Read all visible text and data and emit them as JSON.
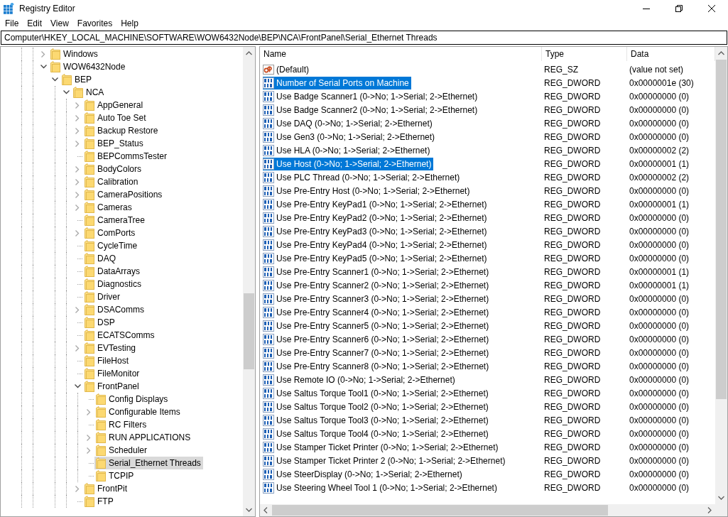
{
  "window": {
    "title": "Registry Editor"
  },
  "menu": [
    "File",
    "Edit",
    "View",
    "Favorites",
    "Help"
  ],
  "address": "Computer\\HKEY_LOCAL_MACHINE\\SOFTWARE\\WOW6432Node\\BEP\\NCA\\FrontPanel\\Serial_Ethernet Threads",
  "tree": [
    {
      "label": "Windows",
      "kind": "collapsed",
      "selected": false
    },
    {
      "label": "WOW6432Node",
      "kind": "expanded",
      "selected": false,
      "children": [
        {
          "label": "BEP",
          "kind": "expanded",
          "selected": false,
          "children": [
            {
              "label": "NCA",
              "kind": "expanded",
              "selected": false,
              "children": [
                {
                  "label": "AppGeneral",
                  "kind": "collapsed",
                  "selected": false
                },
                {
                  "label": "Auto Toe Set",
                  "kind": "collapsed",
                  "selected": false
                },
                {
                  "label": "Backup Restore",
                  "kind": "collapsed",
                  "selected": false
                },
                {
                  "label": "BEP_Status",
                  "kind": "collapsed",
                  "selected": false
                },
                {
                  "label": "BEPCommsTester",
                  "kind": "leaf",
                  "selected": false
                },
                {
                  "label": "BodyColors",
                  "kind": "collapsed",
                  "selected": false
                },
                {
                  "label": "Calibration",
                  "kind": "collapsed",
                  "selected": false
                },
                {
                  "label": "CameraPositions",
                  "kind": "collapsed",
                  "selected": false
                },
                {
                  "label": "Cameras",
                  "kind": "collapsed",
                  "selected": false
                },
                {
                  "label": "CameraTree",
                  "kind": "leaf",
                  "selected": false
                },
                {
                  "label": "ComPorts",
                  "kind": "collapsed",
                  "selected": false
                },
                {
                  "label": "CycleTime",
                  "kind": "leaf",
                  "selected": false
                },
                {
                  "label": "DAQ",
                  "kind": "leaf",
                  "selected": false
                },
                {
                  "label": "DataArrays",
                  "kind": "leaf",
                  "selected": false
                },
                {
                  "label": "Diagnostics",
                  "kind": "leaf",
                  "selected": false
                },
                {
                  "label": "Driver",
                  "kind": "leaf",
                  "selected": false
                },
                {
                  "label": "DSAComms",
                  "kind": "collapsed",
                  "selected": false
                },
                {
                  "label": "DSP",
                  "kind": "leaf",
                  "selected": false
                },
                {
                  "label": "ECATSComms",
                  "kind": "leaf",
                  "selected": false
                },
                {
                  "label": "EVTesting",
                  "kind": "collapsed",
                  "selected": false
                },
                {
                  "label": "FileHost",
                  "kind": "leaf",
                  "selected": false
                },
                {
                  "label": "FileMonitor",
                  "kind": "leaf",
                  "selected": false
                },
                {
                  "label": "FrontPanel",
                  "kind": "expanded",
                  "selected": false,
                  "children": [
                    {
                      "label": "Config Displays",
                      "kind": "leaf",
                      "selected": false
                    },
                    {
                      "label": "Configurable Items",
                      "kind": "collapsed",
                      "selected": false
                    },
                    {
                      "label": "RC Filters",
                      "kind": "leaf",
                      "selected": false
                    },
                    {
                      "label": "RUN APPLICATIONS",
                      "kind": "collapsed",
                      "selected": false
                    },
                    {
                      "label": "Scheduler",
                      "kind": "collapsed",
                      "selected": false
                    },
                    {
                      "label": "Serial_Ethernet Threads",
                      "kind": "leaf",
                      "selected": true
                    },
                    {
                      "label": "TCPIP",
                      "kind": "leaf",
                      "selected": false
                    }
                  ]
                },
                {
                  "label": "FrontPit",
                  "kind": "collapsed",
                  "selected": false
                },
                {
                  "label": "FTP",
                  "kind": "leaf",
                  "selected": false
                }
              ]
            }
          ]
        }
      ]
    }
  ],
  "columns": [
    "Name",
    "Type",
    "Data"
  ],
  "rows": [
    {
      "kind": "string",
      "name": "(Default)",
      "type": "REG_SZ",
      "data": "(value not set)",
      "selected": false
    },
    {
      "kind": "binary",
      "name": "Number of Serial Ports on Machine",
      "type": "REG_DWORD",
      "data": "0x0000001e (30)",
      "selected": true
    },
    {
      "kind": "binary",
      "name": "Use Badge Scanner1 (0->No; 1->Serial; 2->Ethernet)",
      "type": "REG_DWORD",
      "data": "0x00000000 (0)",
      "selected": false
    },
    {
      "kind": "binary",
      "name": "Use Badge Scanner2 (0->No; 1->Serial; 2->Ethernet)",
      "type": "REG_DWORD",
      "data": "0x00000000 (0)",
      "selected": false
    },
    {
      "kind": "binary",
      "name": "Use DAQ (0->No; 1->Serial; 2->Ethernet)",
      "type": "REG_DWORD",
      "data": "0x00000000 (0)",
      "selected": false
    },
    {
      "kind": "binary",
      "name": "Use Gen3 (0->No; 1->Serial; 2->Ethernet)",
      "type": "REG_DWORD",
      "data": "0x00000000 (0)",
      "selected": false
    },
    {
      "kind": "binary",
      "name": "Use HLA (0->No; 1->Serial; 2->Ethernet)",
      "type": "REG_DWORD",
      "data": "0x00000002 (2)",
      "selected": false
    },
    {
      "kind": "binary",
      "name": "Use Host (0->No; 1->Serial; 2->Ethernet)",
      "type": "REG_DWORD",
      "data": "0x00000001 (1)",
      "selected": true
    },
    {
      "kind": "binary",
      "name": "Use PLC Thread (0->No; 1->Serial; 2->Ethernet)",
      "type": "REG_DWORD",
      "data": "0x00000002 (2)",
      "selected": false
    },
    {
      "kind": "binary",
      "name": "Use Pre-Entry Host (0->No; 1->Serial; 2->Ethernet)",
      "type": "REG_DWORD",
      "data": "0x00000000 (0)",
      "selected": false
    },
    {
      "kind": "binary",
      "name": "Use Pre-Entry KeyPad1 (0->No; 1->Serial; 2->Ethernet)",
      "type": "REG_DWORD",
      "data": "0x00000001 (1)",
      "selected": false
    },
    {
      "kind": "binary",
      "name": "Use Pre-Entry KeyPad2 (0->No; 1->Serial; 2->Ethernet)",
      "type": "REG_DWORD",
      "data": "0x00000000 (0)",
      "selected": false
    },
    {
      "kind": "binary",
      "name": "Use Pre-Entry KeyPad3 (0->No; 1->Serial; 2->Ethernet)",
      "type": "REG_DWORD",
      "data": "0x00000000 (0)",
      "selected": false
    },
    {
      "kind": "binary",
      "name": "Use Pre-Entry KeyPad4 (0->No; 1->Serial; 2->Ethernet)",
      "type": "REG_DWORD",
      "data": "0x00000000 (0)",
      "selected": false
    },
    {
      "kind": "binary",
      "name": "Use Pre-Entry KeyPad5 (0->No; 1->Serial; 2->Ethernet)",
      "type": "REG_DWORD",
      "data": "0x00000000 (0)",
      "selected": false
    },
    {
      "kind": "binary",
      "name": "Use Pre-Entry Scanner1 (0->No; 1->Serial; 2->Ethernet)",
      "type": "REG_DWORD",
      "data": "0x00000001 (1)",
      "selected": false
    },
    {
      "kind": "binary",
      "name": "Use Pre-Entry Scanner2 (0->No; 1->Serial; 2->Ethernet)",
      "type": "REG_DWORD",
      "data": "0x00000001 (1)",
      "selected": false
    },
    {
      "kind": "binary",
      "name": "Use Pre-Entry Scanner3 (0->No; 1->Serial; 2->Ethernet)",
      "type": "REG_DWORD",
      "data": "0x00000000 (0)",
      "selected": false
    },
    {
      "kind": "binary",
      "name": "Use Pre-Entry Scanner4 (0->No; 1->Serial; 2->Ethernet)",
      "type": "REG_DWORD",
      "data": "0x00000000 (0)",
      "selected": false
    },
    {
      "kind": "binary",
      "name": "Use Pre-Entry Scanner5 (0->No; 1->Serial; 2->Ethernet)",
      "type": "REG_DWORD",
      "data": "0x00000000 (0)",
      "selected": false
    },
    {
      "kind": "binary",
      "name": "Use Pre-Entry Scanner6 (0->No; 1->Serial; 2->Ethernet)",
      "type": "REG_DWORD",
      "data": "0x00000000 (0)",
      "selected": false
    },
    {
      "kind": "binary",
      "name": "Use Pre-Entry Scanner7 (0->No; 1->Serial; 2->Ethernet)",
      "type": "REG_DWORD",
      "data": "0x00000000 (0)",
      "selected": false
    },
    {
      "kind": "binary",
      "name": "Use Pre-Entry Scanner8 (0->No; 1->Serial; 2->Ethernet)",
      "type": "REG_DWORD",
      "data": "0x00000000 (0)",
      "selected": false
    },
    {
      "kind": "binary",
      "name": "Use Remote IO (0->No; 1->Serial; 2->Ethernet)",
      "type": "REG_DWORD",
      "data": "0x00000000 (0)",
      "selected": false
    },
    {
      "kind": "binary",
      "name": "Use Saltus Torque Tool1 (0->No; 1->Serial; 2->Ethernet)",
      "type": "REG_DWORD",
      "data": "0x00000000 (0)",
      "selected": false
    },
    {
      "kind": "binary",
      "name": "Use Saltus Torque Tool2 (0->No; 1->Serial; 2->Ethernet)",
      "type": "REG_DWORD",
      "data": "0x00000000 (0)",
      "selected": false
    },
    {
      "kind": "binary",
      "name": "Use Saltus Torque Tool3 (0->No; 1->Serial; 2->Ethernet)",
      "type": "REG_DWORD",
      "data": "0x00000000 (0)",
      "selected": false
    },
    {
      "kind": "binary",
      "name": "Use Saltus Torque Tool4 (0->No; 1->Serial; 2->Ethernet)",
      "type": "REG_DWORD",
      "data": "0x00000000 (0)",
      "selected": false
    },
    {
      "kind": "binary",
      "name": "Use Stamper Ticket Printer (0->No; 1->Serial; 2->Ethernet)",
      "type": "REG_DWORD",
      "data": "0x00000000 (0)",
      "selected": false
    },
    {
      "kind": "binary",
      "name": "Use Stamper Ticket Printer 2 (0->No; 1->Serial; 2->Ethernet)",
      "type": "REG_DWORD",
      "data": "0x00000000 (0)",
      "selected": false
    },
    {
      "kind": "binary",
      "name": "Use SteerDisplay (0->No; 1->Serial; 2->Ethernet)",
      "type": "REG_DWORD",
      "data": "0x00000000 (0)",
      "selected": false
    },
    {
      "kind": "binary",
      "name": "Use Steering Wheel Tool 1 (0->No; 1->Serial; 2->Ethernet)",
      "type": "REG_DWORD",
      "data": "0x00000000 (0)",
      "selected": false
    }
  ]
}
